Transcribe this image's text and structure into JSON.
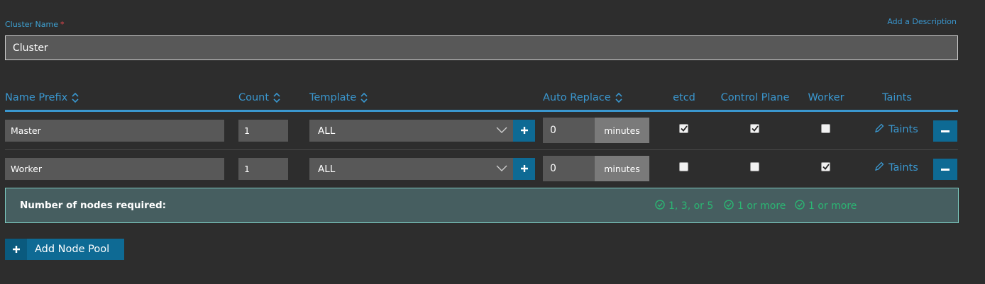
{
  "cluster": {
    "name_label": "Cluster Name",
    "required_mark": "*",
    "add_description_label": "Add a Description",
    "name_value": "Cluster"
  },
  "table": {
    "headers": {
      "name_prefix": "Name Prefix",
      "count": "Count",
      "template": "Template",
      "auto_replace": "Auto Replace",
      "etcd": "etcd",
      "control_plane": "Control Plane",
      "worker": "Worker",
      "taints": "Taints"
    },
    "rows": [
      {
        "name_prefix": "Master",
        "count": "1",
        "template": "ALL",
        "auto_replace_value": "0",
        "auto_replace_unit": "minutes",
        "etcd": true,
        "control_plane": true,
        "worker": false,
        "taints_label": "Taints"
      },
      {
        "name_prefix": "Worker",
        "count": "1",
        "template": "ALL",
        "auto_replace_value": "0",
        "auto_replace_unit": "minutes",
        "etcd": false,
        "control_plane": false,
        "worker": true,
        "taints_label": "Taints"
      }
    ]
  },
  "summary": {
    "label": "Number of nodes required:",
    "requirements": [
      "1, 3, or 5",
      "1 or more",
      "1 or more"
    ]
  },
  "add_node_pool_label": "Add Node Pool",
  "colors": {
    "accent": "#3a97cf",
    "button": "#0e6a94",
    "success": "#2bb673",
    "summary_bg": "#465e60"
  }
}
